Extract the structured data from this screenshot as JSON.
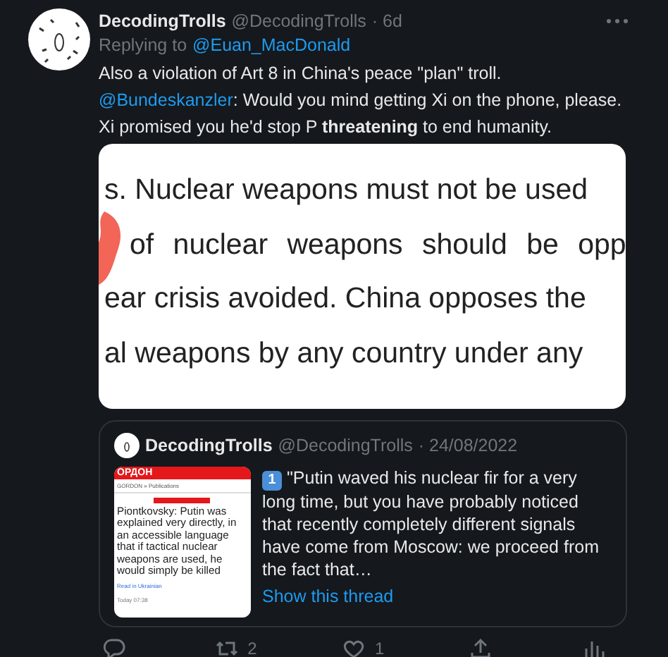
{
  "tweet": {
    "author": {
      "name": "DecodingTrolls",
      "handle": "@DecodingTrolls",
      "time": "· 6d"
    },
    "reply_to": {
      "label": "Replying to",
      "mention": "@Euan_MacDonald"
    },
    "body": [
      {
        "kind": "text",
        "text": "Also a violation of Art 8 in China's peace \"plan\" troll. "
      },
      {
        "kind": "mention",
        "text": "@Bundeskanzler"
      },
      {
        "kind": "text",
        "text": ": Would you mind getting Xi on the phone, please. Xi promised you he'd stop P **threatening** to end humanity."
      }
    ],
    "image_lines": [
      "s. Nuclear weapons must not be used",
      "of nuclear weapons should be opp",
      "ear crisis avoided. China opposes the",
      "al weapons by any country under any"
    ],
    "quote": {
      "name": "DecodingTrolls",
      "handle": "@DecodingTrolls",
      "time": "· 24/08/2022",
      "thumbnail": {
        "brand": "ОРДОН",
        "breadcrumb": "GORDON » Publications",
        "headline": "Piontkovsky: Putin was explained very directly, in an accessible language that if tactical nuclear weapons are used, he would simply be killed",
        "footer": "Read in Ukrainian",
        "date": "Today 07:38"
      },
      "keycap": "1",
      "text": "\"Putin waved his nuclear fir for a very long time, but you have probably noticed that recently completely different signals have come from Moscow: we proceed from the fact that…",
      "link": "Show this thread"
    },
    "actions": [
      {
        "kind": "reply"
      },
      {
        "kind": "retweet",
        "count": "2"
      },
      {
        "kind": "like",
        "count": "1"
      },
      {
        "kind": "share"
      },
      {
        "kind": "analytics"
      }
    ]
  }
}
